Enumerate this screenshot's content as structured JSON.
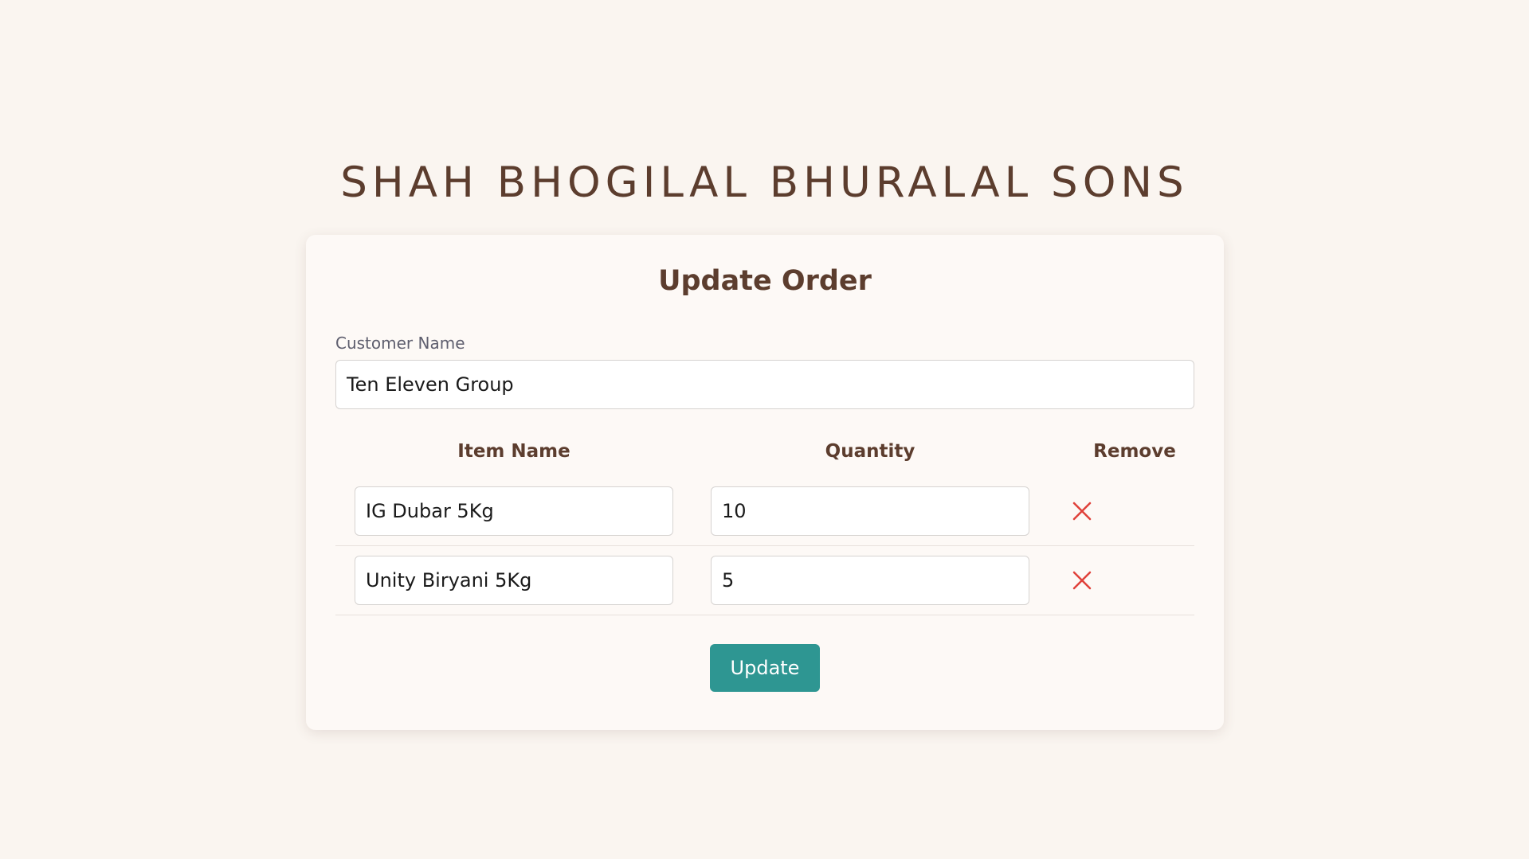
{
  "header": {
    "brand": "SHAH BHOGILAL BHURALAL SONS"
  },
  "form": {
    "title": "Update Order",
    "customer_label": "Customer Name",
    "customer_value": "Ten Eleven Group",
    "columns": {
      "item": "Item Name",
      "quantity": "Quantity",
      "remove": "Remove"
    },
    "rows": [
      {
        "item": "IG Dubar 5Kg",
        "quantity": "10"
      },
      {
        "item": "Unity Biryani 5Kg",
        "quantity": "5"
      }
    ],
    "submit_label": "Update"
  },
  "colors": {
    "background": "#faf5f0",
    "card": "#fdf9f6",
    "brand_text": "#5c3d2e",
    "accent": "#2e9692",
    "remove_icon": "#e0413a"
  },
  "icons": {
    "remove": "close-icon"
  }
}
